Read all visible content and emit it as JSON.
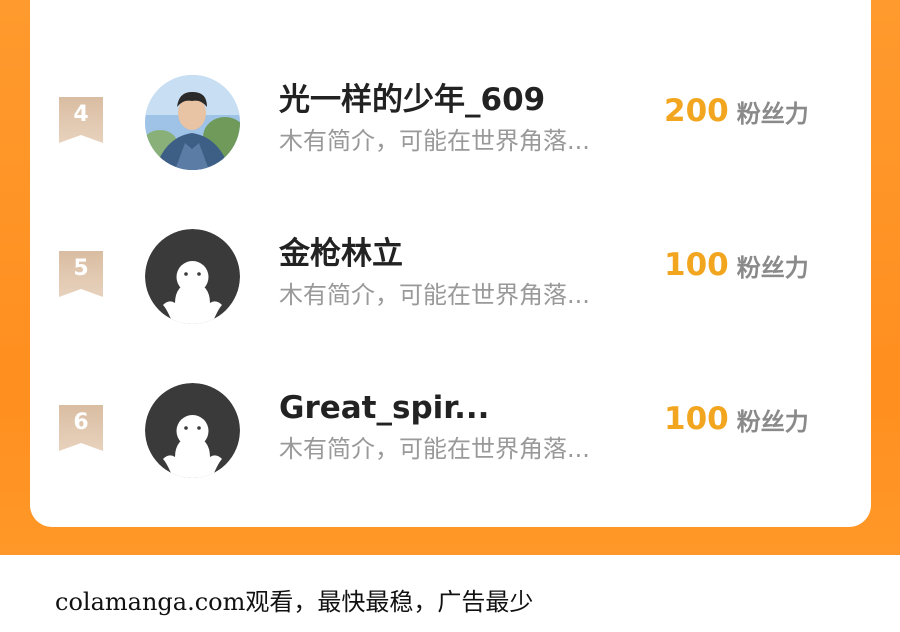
{
  "colors": {
    "background_orange": "#ff9528",
    "card": "#ffffff",
    "score_accent": "#f2a51e",
    "badge": "#d8b89a"
  },
  "ranking": {
    "rows": [
      {
        "rank": "4",
        "name": "光一样的少年_609",
        "bio": "木有简介，可能在世界角落...",
        "score": "200",
        "score_label": "粉丝力",
        "avatar": "photo-avatar"
      },
      {
        "rank": "5",
        "name": "金枪林立",
        "bio": "木有简介，可能在世界角落...",
        "score": "100",
        "score_label": "粉丝力",
        "avatar": "default-avatar"
      },
      {
        "rank": "6",
        "name": "Great_spir...",
        "bio": "木有简介，可能在世界角落...",
        "score": "100",
        "score_label": "粉丝力",
        "avatar": "default-avatar"
      }
    ]
  },
  "footer": {
    "text": "colamanga.com观看，最快最稳，广告最少"
  }
}
